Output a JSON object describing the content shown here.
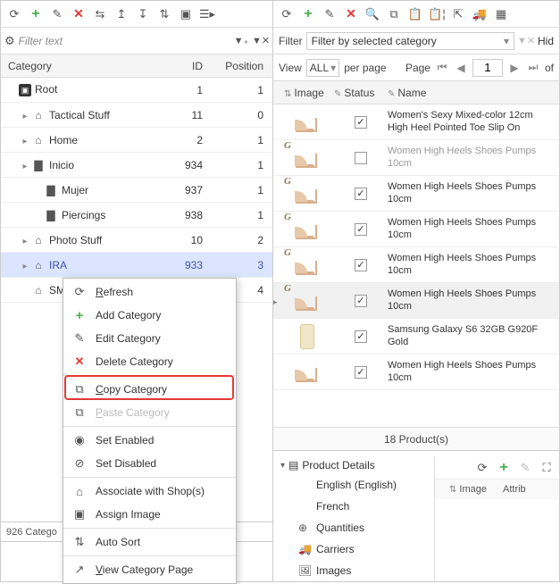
{
  "left": {
    "filter_placeholder": "Filter text",
    "columns": {
      "category": "Category",
      "id": "ID",
      "position": "Position"
    },
    "rows": [
      {
        "label": "Root",
        "id": "1",
        "pos": "1",
        "indent": 0,
        "icon": "root",
        "exp": ""
      },
      {
        "label": "Tactical Stuff",
        "id": "11",
        "pos": "0",
        "indent": 1,
        "icon": "home",
        "exp": "▸"
      },
      {
        "label": "Home",
        "id": "2",
        "pos": "1",
        "indent": 1,
        "icon": "home",
        "exp": "▸"
      },
      {
        "label": "Inicio",
        "id": "934",
        "pos": "1",
        "indent": 1,
        "icon": "folder",
        "exp": "▸"
      },
      {
        "label": "Mujer",
        "id": "937",
        "pos": "1",
        "indent": 2,
        "icon": "folder",
        "exp": ""
      },
      {
        "label": "Piercings",
        "id": "938",
        "pos": "1",
        "indent": 2,
        "icon": "folder",
        "exp": ""
      },
      {
        "label": "Photo Stuff",
        "id": "10",
        "pos": "2",
        "indent": 1,
        "icon": "home",
        "exp": "▸"
      },
      {
        "label": "IRA",
        "id": "933",
        "pos": "3",
        "indent": 1,
        "icon": "home",
        "exp": "▸",
        "selected": true
      },
      {
        "label": "SM",
        "id": "",
        "pos": "4",
        "indent": 1,
        "icon": "home",
        "exp": ""
      }
    ],
    "status": "926 Catego"
  },
  "right": {
    "filter_label": "Filter",
    "filter_value": "Filter by selected category",
    "hide_label": "Hid",
    "view_label": "View",
    "view_value": "ALL",
    "per_page": "per page",
    "page_label": "Page",
    "page_value": "1",
    "of_label": "of",
    "columns": {
      "image": "Image",
      "status": "Status",
      "name": "Name"
    },
    "products": [
      {
        "name": "Women's Sexy Mixed-color 12cm High Heel Pointed Toe Slip On",
        "checked": true,
        "img": "shoe",
        "badge": false,
        "muted": false,
        "selected": false
      },
      {
        "name": "Women High Heels Shoes Pumps 10cm",
        "checked": false,
        "img": "shoe",
        "badge": true,
        "muted": true,
        "selected": false
      },
      {
        "name": "Women High Heels Shoes Pumps 10cm",
        "checked": true,
        "img": "shoe",
        "badge": true,
        "muted": false,
        "selected": false
      },
      {
        "name": "Women High Heels Shoes Pumps 10cm",
        "checked": true,
        "img": "shoe",
        "badge": true,
        "muted": false,
        "selected": false
      },
      {
        "name": "Women High Heels Shoes Pumps 10cm",
        "checked": true,
        "img": "shoe",
        "badge": true,
        "muted": false,
        "selected": false
      },
      {
        "name": "Women High Heels Shoes Pumps 10cm",
        "checked": true,
        "img": "shoe",
        "badge": true,
        "muted": false,
        "selected": true
      },
      {
        "name": "Samsung Galaxy S6 32GB G920F Gold",
        "checked": true,
        "img": "phone",
        "badge": false,
        "muted": false,
        "selected": false
      },
      {
        "name": "Women High Heels Shoes Pumps 10cm",
        "checked": true,
        "img": "shoe",
        "badge": false,
        "muted": false,
        "selected": false
      }
    ],
    "footer": "18 Product(s)",
    "details": {
      "title": "Product Details",
      "items": [
        {
          "label": "English (English)",
          "icon": ""
        },
        {
          "label": "French",
          "icon": ""
        },
        {
          "label": "Quantities",
          "icon": "⊕"
        },
        {
          "label": "Carriers",
          "icon": "🚚"
        },
        {
          "label": "Images",
          "icon": "🖼"
        }
      ],
      "mini_cols": {
        "image": "Image",
        "attrib": "Attrib"
      }
    }
  },
  "ctx": {
    "items": [
      {
        "label_pre": "",
        "ul": "R",
        "label_post": "efresh",
        "icon": "⟳",
        "disabled": false,
        "sep": false
      },
      {
        "label_pre": "Add Category",
        "ul": "",
        "label_post": "",
        "icon": "+",
        "icon_class": "green",
        "disabled": false,
        "sep": false
      },
      {
        "label_pre": "Edit Category",
        "ul": "",
        "label_post": "",
        "icon": "✎",
        "disabled": false,
        "sep": false
      },
      {
        "label_pre": "Delete Category",
        "ul": "",
        "label_post": "",
        "icon": "✕",
        "icon_class": "red",
        "disabled": false,
        "sep": true
      },
      {
        "label_pre": "",
        "ul": "C",
        "label_post": "opy Category",
        "icon": "⧉",
        "disabled": false,
        "sep": false
      },
      {
        "label_pre": "",
        "ul": "P",
        "label_post": "aste Category",
        "icon": "⧉",
        "disabled": true,
        "sep": true
      },
      {
        "label_pre": "Set Enabled",
        "ul": "",
        "label_post": "",
        "icon": "◉",
        "disabled": false,
        "sep": false
      },
      {
        "label_pre": "Set Disabled",
        "ul": "",
        "label_post": "",
        "icon": "⊘",
        "disabled": false,
        "sep": true
      },
      {
        "label_pre": "Associate with Shop(s)",
        "ul": "",
        "label_post": "",
        "icon": "⌂",
        "disabled": false,
        "sep": false
      },
      {
        "label_pre": "Assign Image",
        "ul": "",
        "label_post": "",
        "icon": "▣",
        "disabled": false,
        "sep": true
      },
      {
        "label_pre": "Auto Sort",
        "ul": "",
        "label_post": "",
        "icon": "⇅",
        "disabled": false,
        "sep": true
      },
      {
        "label_pre": "",
        "ul": "V",
        "label_post": "iew Category Page",
        "icon": "↗",
        "disabled": false,
        "sep": false
      }
    ]
  }
}
